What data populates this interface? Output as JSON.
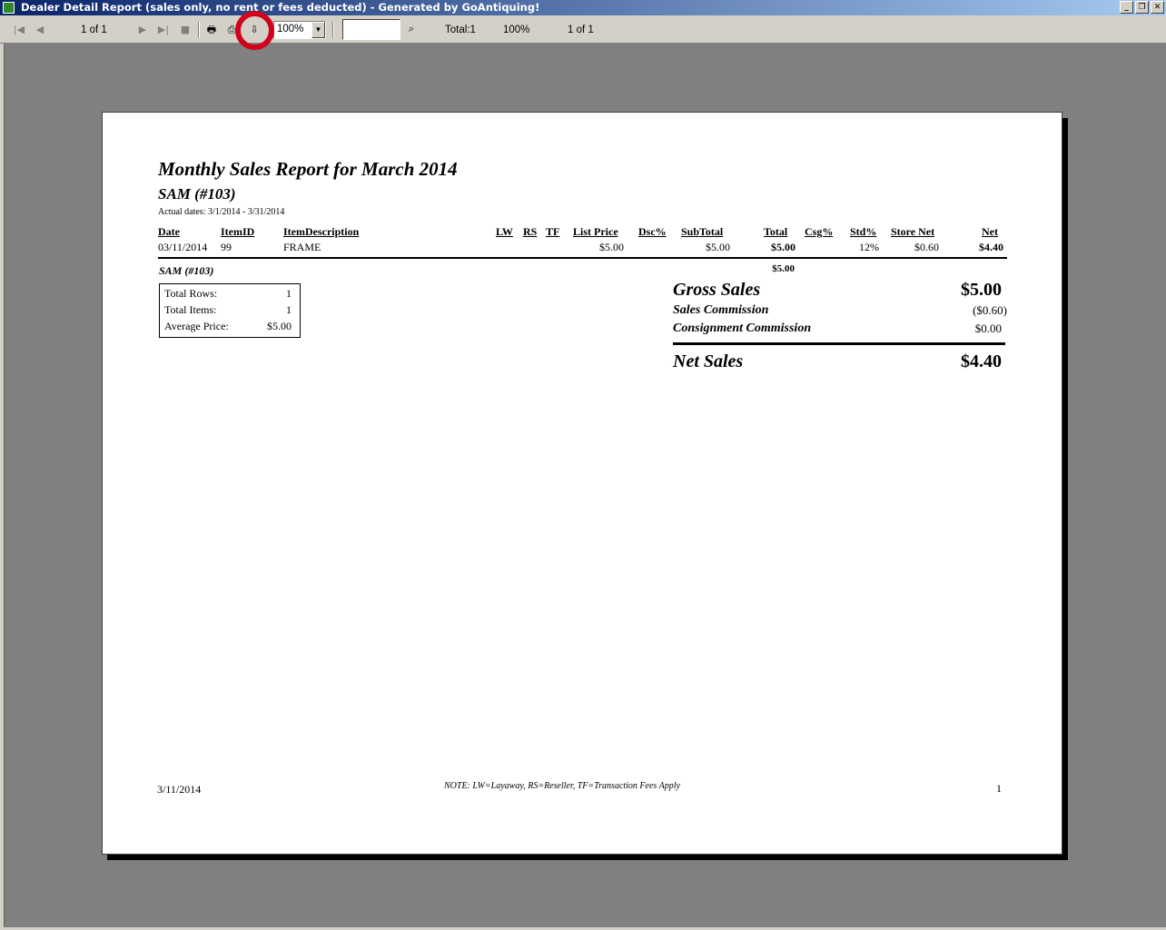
{
  "window": {
    "title": "Dealer Detail Report (sales only, no rent or fees deducted) - Generated by GoAntiquing!",
    "minimize": "_",
    "restore": "❐",
    "close": "✕"
  },
  "toolbar": {
    "page_indicator": "1 of 1",
    "zoom": "100%",
    "search_value": "",
    "total": "Total:1",
    "percent": "100%",
    "page_count": "1 of 1"
  },
  "report": {
    "title": "Monthly Sales Report for March 2014",
    "dealer": "SAM (#103)",
    "actual_dates": "Actual dates: 3/1/2014 - 3/31/2014",
    "columns": {
      "date": "Date",
      "item_id": "ItemID",
      "item_description": "ItemDescription",
      "lw": "LW",
      "rs": "RS",
      "tf": "TF",
      "list_price": "List Price",
      "dsc": "Dsc%",
      "subtotal": "SubTotal",
      "total": "Total",
      "csg": "Csg%",
      "std": "Std%",
      "store_net": "Store Net",
      "net": "Net"
    },
    "rows": [
      {
        "date": "03/11/2014",
        "item_id": "99",
        "item_description": "FRAME",
        "list_price": "$5.00",
        "subtotal": "$5.00",
        "total": "$5.00",
        "std": "12%",
        "store_net": "$0.60",
        "net": "$4.40"
      }
    ],
    "group_name": "SAM (#103)",
    "group_total": "$5.00",
    "stats": {
      "total_rows_label": "Total Rows:",
      "total_rows": "1",
      "total_items_label": "Total Items:",
      "total_items": "1",
      "average_price_label": "Average Price:",
      "average_price": "$5.00"
    },
    "summary": {
      "gross_sales_label": "Gross Sales",
      "gross_sales": "$5.00",
      "sales_commission_label": "Sales Commission",
      "sales_commission": "($0.60)",
      "consignment_commission_label": "Consignment Commission",
      "consignment_commission": "$0.00",
      "net_sales_label": "Net Sales",
      "net_sales": "$4.40"
    },
    "footer": {
      "date": "3/11/2014",
      "note": "NOTE:  LW=Layaway, RS=Reseller, TF=Transaction Fees Apply",
      "page_number": "1"
    }
  },
  "colors": {
    "title_bar_start": "#0a246a",
    "title_bar_end": "#a6caf0",
    "workspace": "#808080",
    "highlight_ring": "#d0021b"
  }
}
